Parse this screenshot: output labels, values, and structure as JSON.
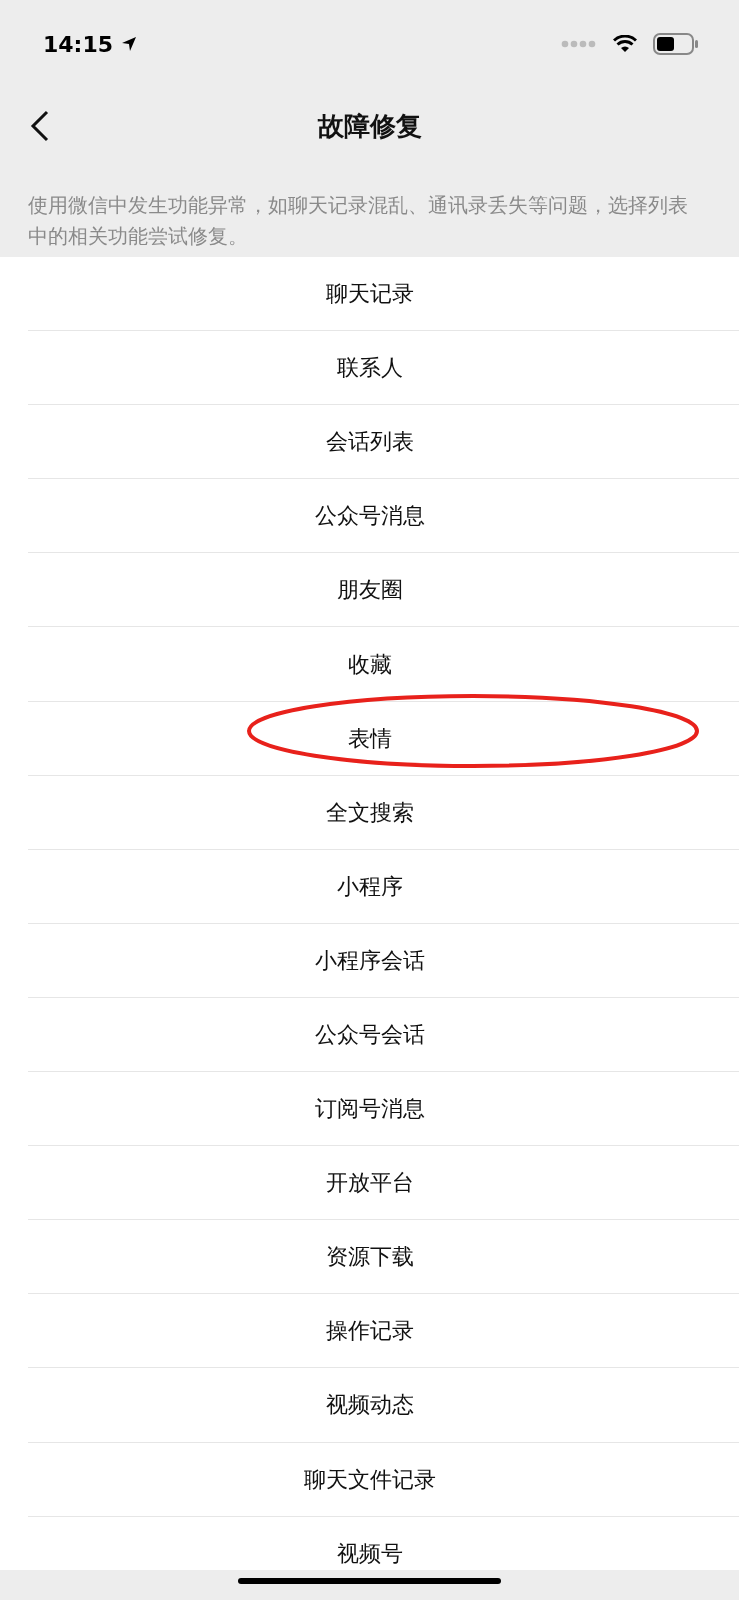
{
  "status_bar": {
    "time": "14:15"
  },
  "header": {
    "title": "故障修复"
  },
  "description": "使用微信中发生功能异常，如聊天记录混乱、通讯录丢失等问题，选择列表中的相关功能尝试修复。",
  "items": [
    {
      "label": "聊天记录",
      "highlighted": false
    },
    {
      "label": "联系人",
      "highlighted": false
    },
    {
      "label": "会话列表",
      "highlighted": false
    },
    {
      "label": "公众号消息",
      "highlighted": false
    },
    {
      "label": "朋友圈",
      "highlighted": false
    },
    {
      "label": "收藏",
      "highlighted": false
    },
    {
      "label": "表情",
      "highlighted": true
    },
    {
      "label": "全文搜索",
      "highlighted": false
    },
    {
      "label": "小程序",
      "highlighted": false
    },
    {
      "label": "小程序会话",
      "highlighted": false
    },
    {
      "label": "公众号会话",
      "highlighted": false
    },
    {
      "label": "订阅号消息",
      "highlighted": false
    },
    {
      "label": "开放平台",
      "highlighted": false
    },
    {
      "label": "资源下载",
      "highlighted": false
    },
    {
      "label": "操作记录",
      "highlighted": false
    },
    {
      "label": "视频动态",
      "highlighted": false
    },
    {
      "label": "聊天文件记录",
      "highlighted": false
    },
    {
      "label": "视频号",
      "highlighted": false
    }
  ]
}
